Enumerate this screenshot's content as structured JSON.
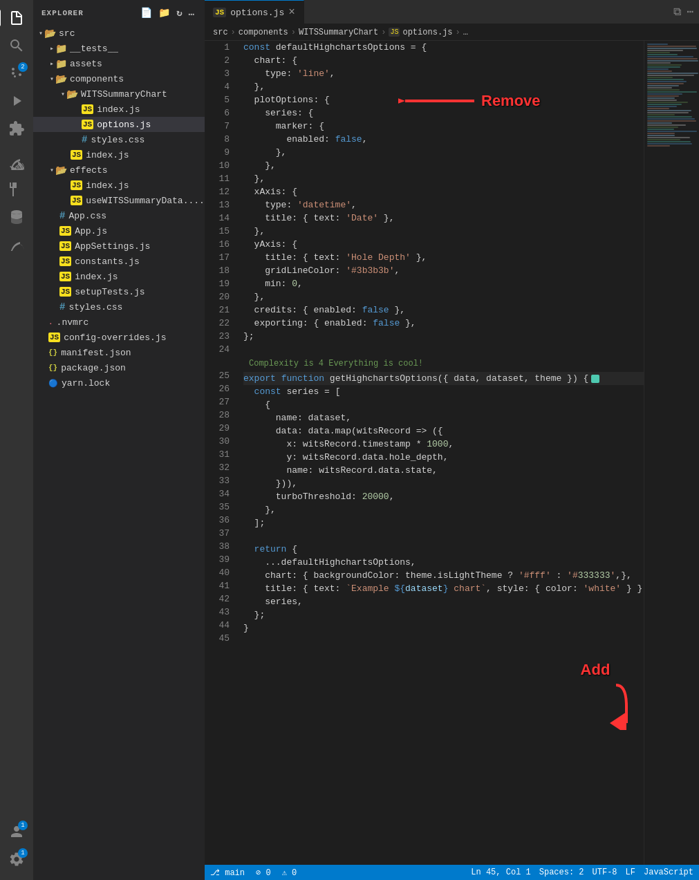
{
  "activity": {
    "icons": [
      "explorer",
      "search",
      "source-control",
      "run",
      "extensions",
      "remote",
      "test",
      "database",
      "account"
    ],
    "active": "explorer",
    "source_control_badge": "2"
  },
  "sidebar": {
    "header": "EXPLORER",
    "tree": [
      {
        "id": "src",
        "label": "src",
        "type": "folder",
        "indent": 0,
        "expanded": true
      },
      {
        "id": "__tests__",
        "label": "__tests__",
        "type": "folder",
        "indent": 1,
        "expanded": false
      },
      {
        "id": "assets",
        "label": "assets",
        "type": "folder",
        "indent": 1,
        "expanded": false
      },
      {
        "id": "components",
        "label": "components",
        "type": "folder",
        "indent": 1,
        "expanded": true
      },
      {
        "id": "WITSSummaryChart",
        "label": "WITSSummaryChart",
        "type": "folder",
        "indent": 2,
        "expanded": true
      },
      {
        "id": "index.js-1",
        "label": "index.js",
        "type": "js",
        "indent": 3
      },
      {
        "id": "options.js",
        "label": "options.js",
        "type": "js",
        "indent": 3,
        "selected": true
      },
      {
        "id": "styles.css-1",
        "label": "styles.css",
        "type": "css",
        "indent": 3
      },
      {
        "id": "index.js-2",
        "label": "index.js",
        "type": "js",
        "indent": 2
      },
      {
        "id": "effects",
        "label": "effects",
        "type": "folder",
        "indent": 1,
        "expanded": true
      },
      {
        "id": "effects-index",
        "label": "index.js",
        "type": "js",
        "indent": 2
      },
      {
        "id": "useWITSSummaryData",
        "label": "useWITSSummaryData....",
        "type": "js",
        "indent": 2
      },
      {
        "id": "App.css",
        "label": "App.css",
        "type": "css",
        "indent": 1
      },
      {
        "id": "App.js",
        "label": "App.js",
        "type": "js",
        "indent": 1
      },
      {
        "id": "AppSettings.js",
        "label": "AppSettings.js",
        "type": "js",
        "indent": 1
      },
      {
        "id": "constants.js",
        "label": "constants.js",
        "type": "js",
        "indent": 1
      },
      {
        "id": "index.js-3",
        "label": "index.js",
        "type": "js",
        "indent": 1
      },
      {
        "id": "setupTests.js",
        "label": "setupTests.js",
        "type": "js",
        "indent": 1
      },
      {
        "id": "styles.css-2",
        "label": "styles.css",
        "type": "css",
        "indent": 1
      },
      {
        "id": ".nvmrc",
        "label": ".nvmrc",
        "type": "nvmrc",
        "indent": 0
      },
      {
        "id": "config-overrides.js",
        "label": "config-overrides.js",
        "type": "js",
        "indent": 0
      },
      {
        "id": "manifest.json",
        "label": "manifest.json",
        "type": "json",
        "indent": 0
      },
      {
        "id": "package.json",
        "label": "package.json",
        "type": "json",
        "indent": 0
      },
      {
        "id": "yarn.lock",
        "label": "yarn.lock",
        "type": "yarn",
        "indent": 0
      }
    ]
  },
  "tabs": [
    {
      "label": "options.js",
      "type": "js",
      "active": true
    }
  ],
  "breadcrumb": {
    "parts": [
      "src",
      "components",
      "WITSSummaryChart",
      "JS options.js",
      "…"
    ]
  },
  "editor": {
    "filename": "options.js",
    "complexity_line": "Complexity is 4 Everything is cool!",
    "lines": [
      {
        "num": 1,
        "code": "const defaultHighchartsOptions = {"
      },
      {
        "num": 2,
        "code": "  chart: {"
      },
      {
        "num": 3,
        "code": "    type: 'line',"
      },
      {
        "num": 4,
        "code": "  },"
      },
      {
        "num": 5,
        "code": "  plotOptions: {"
      },
      {
        "num": 6,
        "code": "    series: {"
      },
      {
        "num": 7,
        "code": "      marker: {"
      },
      {
        "num": 8,
        "code": "        enabled: false,"
      },
      {
        "num": 9,
        "code": "      },"
      },
      {
        "num": 10,
        "code": "    },"
      },
      {
        "num": 11,
        "code": "  },"
      },
      {
        "num": 12,
        "code": "  xAxis: {"
      },
      {
        "num": 13,
        "code": "    type: 'datetime',"
      },
      {
        "num": 14,
        "code": "    title: { text: 'Date' },"
      },
      {
        "num": 15,
        "code": "  },"
      },
      {
        "num": 16,
        "code": "  yAxis: {"
      },
      {
        "num": 17,
        "code": "    title: { text: 'Hole Depth' },"
      },
      {
        "num": 18,
        "code": "    gridLineColor: '#3b3b3b',"
      },
      {
        "num": 19,
        "code": "    min: 0,"
      },
      {
        "num": 20,
        "code": "  },"
      },
      {
        "num": 21,
        "code": "  credits: { enabled: false },"
      },
      {
        "num": 22,
        "code": "  exporting: { enabled: false },"
      },
      {
        "num": 23,
        "code": "};"
      },
      {
        "num": 24,
        "code": ""
      },
      {
        "num": 25,
        "code": "export function getHighchartsOptions({ data, dataset, theme }) {"
      },
      {
        "num": 26,
        "code": "  const series = ["
      },
      {
        "num": 27,
        "code": "    {"
      },
      {
        "num": 28,
        "code": "      name: dataset,"
      },
      {
        "num": 29,
        "code": "      data: data.map(witsRecord => ({"
      },
      {
        "num": 30,
        "code": "        x: witsRecord.timestamp * 1000,"
      },
      {
        "num": 31,
        "code": "        y: witsRecord.data.hole_depth,"
      },
      {
        "num": 32,
        "code": "        name: witsRecord.data.state,"
      },
      {
        "num": 33,
        "code": "      })),"
      },
      {
        "num": 34,
        "code": "      turboThreshold: 20000,"
      },
      {
        "num": 35,
        "code": "    },"
      },
      {
        "num": 36,
        "code": "  ];"
      },
      {
        "num": 37,
        "code": ""
      },
      {
        "num": 38,
        "code": "  return {"
      },
      {
        "num": 39,
        "code": "    ...defaultHighchartsOptions,"
      },
      {
        "num": 40,
        "code": "    chart: { backgroundColor: theme.isLightTheme ? '#fff' : '#333333',},"
      },
      {
        "num": 41,
        "code": "    title: { text: `Example ${dataset} chart`, style: { color: 'white' } },"
      },
      {
        "num": 42,
        "code": "    series,"
      },
      {
        "num": 43,
        "code": "  };"
      },
      {
        "num": 44,
        "code": "}"
      },
      {
        "num": 45,
        "code": ""
      }
    ]
  },
  "annotations": {
    "remove_label": "Remove",
    "add_label": "Add"
  },
  "status_bar": {
    "branch": "main",
    "errors": "0",
    "warnings": "0",
    "ln": "45",
    "col": "1",
    "spaces": "Spaces: 2",
    "encoding": "UTF-8",
    "line_ending": "LF",
    "language": "JavaScript",
    "account_badge": "1",
    "notification_badge": "1"
  }
}
